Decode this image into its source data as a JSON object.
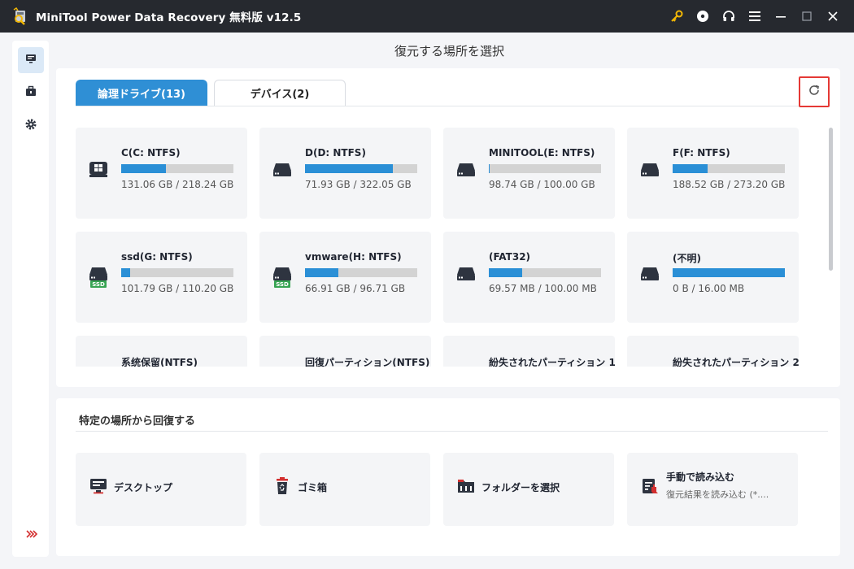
{
  "app": {
    "title": "MiniTool Power Data Recovery 無料版 v12.5",
    "icons": [
      "key-icon",
      "disc-icon",
      "headphones-icon",
      "menu-icon",
      "minimize-icon",
      "maximize-icon",
      "close-icon"
    ],
    "accent_color": "#2f8fd5",
    "key_color": "#f2b705"
  },
  "sidebar": {
    "items": [
      {
        "name": "recovery",
        "icon": "monitor-icon",
        "active": true
      },
      {
        "name": "tools",
        "icon": "toolbox-icon",
        "active": false
      },
      {
        "name": "settings",
        "icon": "gear-icon",
        "active": false
      }
    ],
    "expand_icon": "expand-chevrons-icon"
  },
  "page": {
    "title": "復元する場所を選択"
  },
  "tabs": [
    {
      "label": "論理ドライブ(13)",
      "active": true
    },
    {
      "label": "デバイス(2)",
      "active": false
    }
  ],
  "drives": [
    {
      "name": "C(C: NTFS)",
      "size": "131.06 GB / 218.24 GB",
      "used_fraction": 0.4,
      "type": "windows",
      "ssd": false
    },
    {
      "name": "D(D: NTFS)",
      "size": "71.93 GB / 322.05 GB",
      "used_fraction": 0.78,
      "type": "hdd",
      "ssd": false
    },
    {
      "name": "MINITOOL(E: NTFS)",
      "size": "98.74 GB / 100.00 GB",
      "used_fraction": 0.01,
      "type": "hdd",
      "ssd": false
    },
    {
      "name": "F(F: NTFS)",
      "size": "188.52 GB / 273.20 GB",
      "used_fraction": 0.31,
      "type": "hdd",
      "ssd": false
    },
    {
      "name": "ssd(G: NTFS)",
      "size": "101.79 GB / 110.20 GB",
      "used_fraction": 0.08,
      "type": "hdd",
      "ssd": true
    },
    {
      "name": "vmware(H: NTFS)",
      "size": "66.91 GB / 96.71 GB",
      "used_fraction": 0.3,
      "type": "hdd",
      "ssd": true
    },
    {
      "name": "(FAT32)",
      "size": "69.57 MB / 100.00 MB",
      "used_fraction": 0.3,
      "type": "hdd",
      "ssd": false
    },
    {
      "name": "(不明)",
      "size": "0 B / 16.00 MB",
      "used_fraction": 1.0,
      "type": "hdd",
      "ssd": false
    },
    {
      "name": "系统保留(NTFS)",
      "size": "",
      "used_fraction": 0,
      "type": "none",
      "ssd": false
    },
    {
      "name": "回復パーティション(NTFS)",
      "size": "",
      "used_fraction": 0,
      "type": "none",
      "ssd": false
    },
    {
      "name": "紛失されたパーティション 1",
      "size": "",
      "used_fraction": 0,
      "type": "none",
      "ssd": false
    },
    {
      "name": "紛失されたパーティション 2",
      "size": "",
      "used_fraction": 0,
      "type": "none",
      "ssd": false
    }
  ],
  "ssd_badge": "SSD",
  "locations": {
    "title": "特定の場所から回復する",
    "items": [
      {
        "label": "デスクトップ",
        "icon": "desktop-icon"
      },
      {
        "label": "ゴミ箱",
        "icon": "recycle-bin-icon"
      },
      {
        "label": "フォルダーを選択",
        "icon": "folder-icon"
      },
      {
        "label": "手動で読み込む",
        "sub": "復元結果を読み込む (*....",
        "icon": "load-manually-icon"
      }
    ]
  }
}
